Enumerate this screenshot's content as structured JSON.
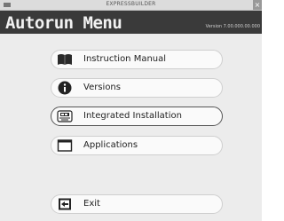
{
  "window": {
    "title": "EXPRESSBUILDER",
    "close_glyph": "×"
  },
  "header": {
    "title": "Autorun Menu",
    "version": "Version 7.00.000.00.000"
  },
  "menu": {
    "items": [
      {
        "label": "Instruction Manual",
        "icon": "book-icon"
      },
      {
        "label": "Versions",
        "icon": "info-icon"
      },
      {
        "label": "Integrated Installation",
        "icon": "installation-icon"
      },
      {
        "label": "Applications",
        "icon": "window-icon"
      }
    ],
    "exit": {
      "label": "Exit",
      "icon": "exit-icon"
    }
  }
}
